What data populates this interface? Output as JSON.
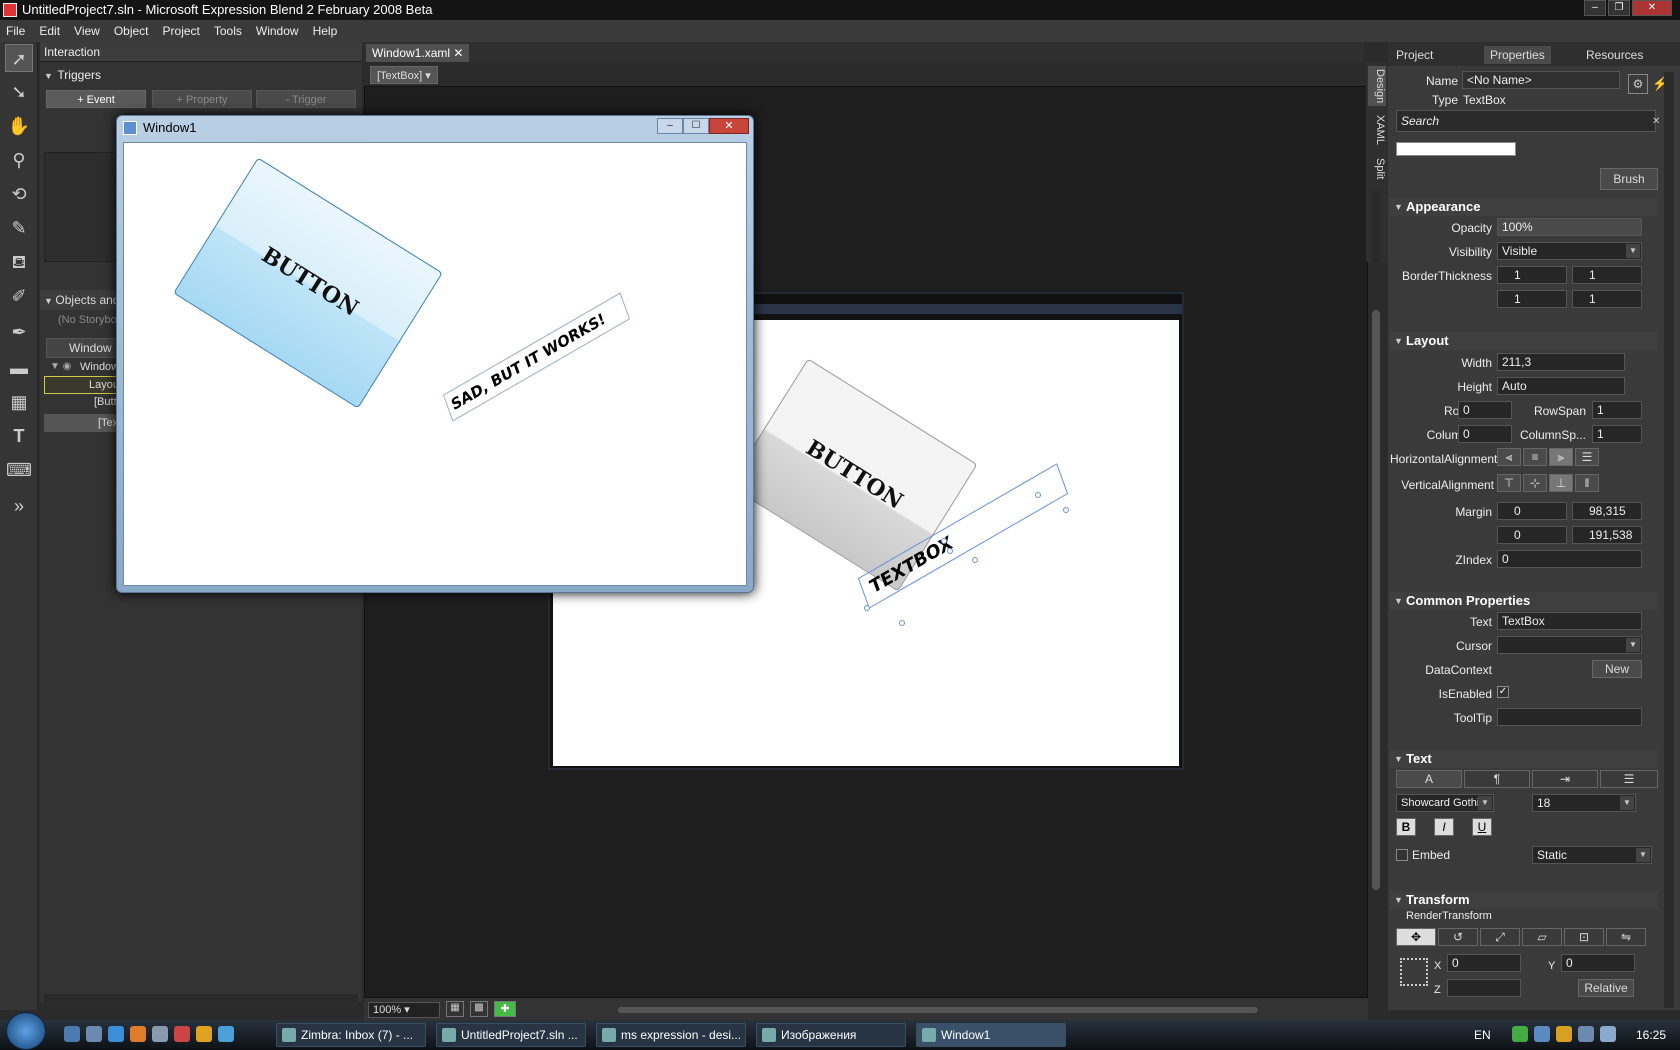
{
  "window": {
    "title": "UntitledProject7.sln - Microsoft Expression Blend 2 February 2008 Beta"
  },
  "menu": [
    "File",
    "Edit",
    "View",
    "Object",
    "Project",
    "Tools",
    "Window",
    "Help"
  ],
  "interaction": {
    "title": "Interaction",
    "triggers_label": "Triggers",
    "event_btn": "+ Event",
    "property_btn": "+ Property",
    "trigger_btn": "- Trigger",
    "objects_label": "Objects and Timeline",
    "storyboard": "(No Storyboard open)",
    "scope": "Window",
    "tree": [
      "Window",
      "LayoutRoot",
      "[Button]",
      "[TextBox]"
    ]
  },
  "document": {
    "tab": "Window1.xaml",
    "breadcrumb": "[TextBox]",
    "design_button_text": "BUTTON",
    "design_textbox_text": "TEXTBOX",
    "zoom": "100%",
    "view_tabs": [
      "Design",
      "XAML",
      "Split"
    ]
  },
  "runtime_window": {
    "title": "Window1",
    "button_text": "BUTTON",
    "textbox_text": "SAD, BUT IT WORKS!"
  },
  "properties": {
    "tabs": [
      "Project",
      "Properties",
      "Resources"
    ],
    "name_label": "Name",
    "name_value": "<No Name>",
    "type_label": "Type",
    "type_value": "TextBox",
    "search_placeholder": "Search",
    "brush_btn": "Brush",
    "appearance": {
      "title": "Appearance",
      "opacity_label": "Opacity",
      "opacity": "100%",
      "visibility_label": "Visibility",
      "visibility": "Visible",
      "border_label": "BorderThickness",
      "border_left": "1",
      "border_right": "1",
      "border_top": "1",
      "border_bottom": "1"
    },
    "layout": {
      "title": "Layout",
      "width_label": "Width",
      "width": "211,3",
      "height_label": "Height",
      "height": "Auto",
      "row_label": "Row",
      "row": "0",
      "rowspan_label": "RowSpan",
      "rowspan": "1",
      "column_label": "Column",
      "column": "0",
      "columnspan_label": "ColumnSp...",
      "columnspan": "1",
      "halign_label": "HorizontalAlignment",
      "valign_label": "VerticalAlignment",
      "margin_label": "Margin",
      "margin_left": "0",
      "margin_right": "98,315",
      "margin_top": "0",
      "margin_bottom": "191,538",
      "zindex_label": "ZIndex",
      "zindex": "0"
    },
    "common": {
      "title": "Common Properties",
      "text_label": "Text",
      "text": "TextBox",
      "cursor_label": "Cursor",
      "cursor": "",
      "datacontext_label": "DataContext",
      "new_btn": "New",
      "isenabled_label": "IsEnabled",
      "tooltip_label": "ToolTip",
      "tooltip": ""
    },
    "text": {
      "title": "Text",
      "font": "Showcard Gothic",
      "size": "18",
      "embed_label": "Embed",
      "mode": "Static"
    },
    "transform": {
      "title": "Transform",
      "render_label": "RenderTransform",
      "x_label": "X",
      "x": "0",
      "y_label": "Y",
      "y": "0",
      "z_label": "Z",
      "z": "",
      "relative_btn": "Relative"
    }
  },
  "taskbar": {
    "tasks": [
      "Zimbra: Inbox (7) - ...",
      "UntitledProject7.sln ...",
      "ms expression - desi...",
      "Изображения",
      "Window1"
    ],
    "lang": "EN",
    "clock": "16:25"
  }
}
